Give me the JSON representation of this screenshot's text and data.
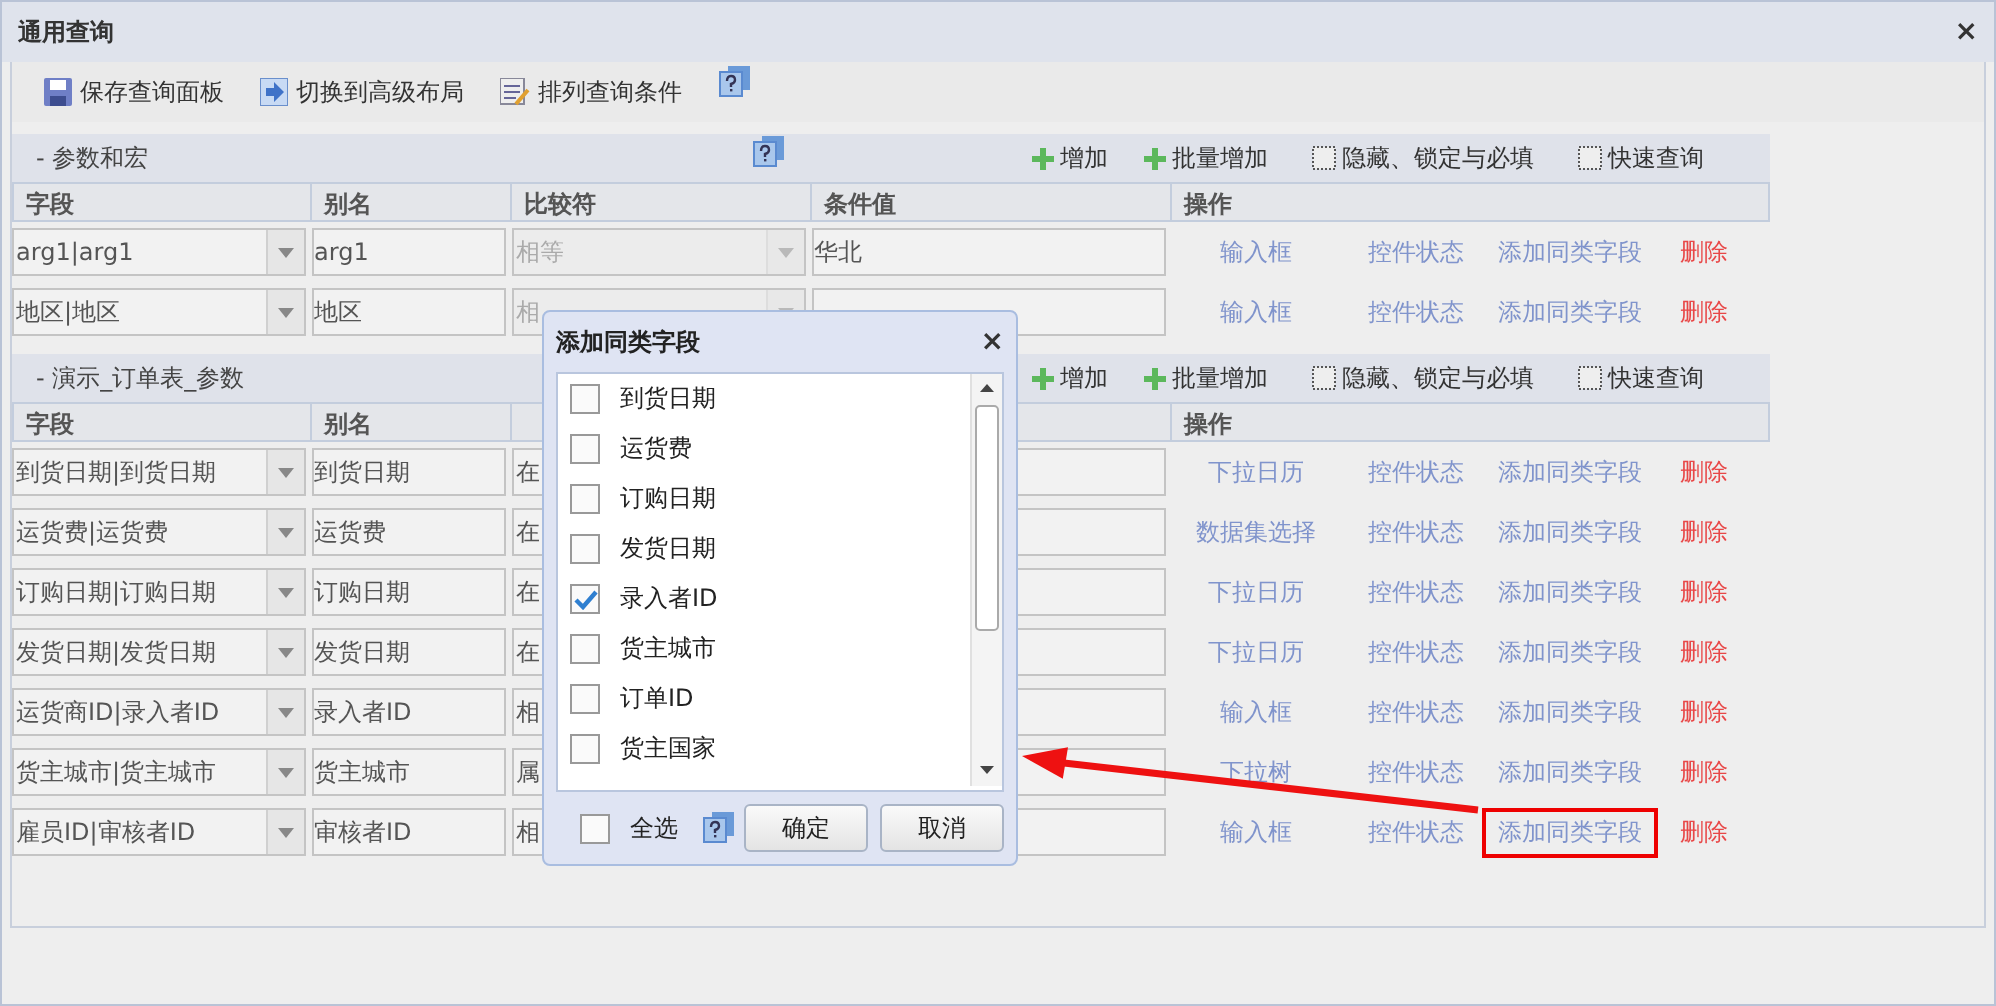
{
  "window": {
    "title": "通用查询",
    "close": "×"
  },
  "toolbar": [
    {
      "label": "保存查询面板",
      "kind": "save"
    },
    {
      "label": "切换到高级布局",
      "kind": "switch"
    },
    {
      "label": "排列查询条件",
      "kind": "sort"
    },
    {
      "kind": "help"
    }
  ],
  "sections": [
    {
      "title": "- 参数和宏",
      "actions": [
        {
          "label": "增加",
          "kind": "add"
        },
        {
          "label": "批量增加",
          "kind": "add"
        },
        {
          "label": "隐藏、锁定与必填",
          "kind": "option"
        },
        {
          "label": "快速查询",
          "kind": "option"
        }
      ],
      "columns": [
        "字段",
        "别名",
        "比较符",
        "条件值",
        "操作"
      ],
      "rows": [
        {
          "field": "arg1|arg1",
          "alias": "arg1",
          "comparator": {
            "text": "相等",
            "disabled": true
          },
          "value": "华北",
          "actions": [
            {
              "label": "输入框",
              "kind": "link",
              "highlighted": false
            },
            {
              "label": "控件状态",
              "kind": "link",
              "highlighted": false
            },
            {
              "label": "添加同类字段",
              "kind": "link",
              "highlighted": false
            },
            {
              "label": "删除",
              "kind": "delete",
              "highlighted": false
            }
          ]
        },
        {
          "field": "地区|地区",
          "alias": "地区",
          "comparator": {
            "text": "相",
            "disabled": true
          },
          "actions": [
            {
              "label": "输入框",
              "kind": "link",
              "highlighted": false
            },
            {
              "label": "控件状态",
              "kind": "link",
              "highlighted": false
            },
            {
              "label": "添加同类字段",
              "kind": "link",
              "highlighted": false
            },
            {
              "label": "删除",
              "kind": "delete",
              "highlighted": false
            }
          ]
        }
      ]
    },
    {
      "title": "- 演示_订单表_参数",
      "actions": [
        {
          "label": "增加",
          "kind": "add"
        },
        {
          "label": "批量增加",
          "kind": "add"
        },
        {
          "label": "隐藏、锁定与必填",
          "kind": "option"
        },
        {
          "label": "快速查询",
          "kind": "option"
        }
      ],
      "columns": [
        "字段",
        "别名",
        null,
        null,
        "操作"
      ],
      "rows": [
        {
          "field": "到货日期|到货日期",
          "alias": "到货日期",
          "comparator": {
            "text": "在",
            "disabled": false
          },
          "actions": [
            {
              "label": "下拉日历",
              "kind": "link",
              "highlighted": false
            },
            {
              "label": "控件状态",
              "kind": "link",
              "highlighted": false
            },
            {
              "label": "添加同类字段",
              "kind": "link",
              "highlighted": false
            },
            {
              "label": "删除",
              "kind": "delete",
              "highlighted": false
            }
          ]
        },
        {
          "field": "运货费|运货费",
          "alias": "运货费",
          "comparator": {
            "text": "在",
            "disabled": false
          },
          "actions": [
            {
              "label": "数据集选择",
              "kind": "link",
              "highlighted": false
            },
            {
              "label": "控件状态",
              "kind": "link",
              "highlighted": false
            },
            {
              "label": "添加同类字段",
              "kind": "link",
              "highlighted": false
            },
            {
              "label": "删除",
              "kind": "delete",
              "highlighted": false
            }
          ]
        },
        {
          "field": "订购日期|订购日期",
          "alias": "订购日期",
          "comparator": {
            "text": "在",
            "disabled": false
          },
          "actions": [
            {
              "label": "下拉日历",
              "kind": "link",
              "highlighted": false
            },
            {
              "label": "控件状态",
              "kind": "link",
              "highlighted": false
            },
            {
              "label": "添加同类字段",
              "kind": "link",
              "highlighted": false
            },
            {
              "label": "删除",
              "kind": "delete",
              "highlighted": false
            }
          ]
        },
        {
          "field": "发货日期|发货日期",
          "alias": "发货日期",
          "comparator": {
            "text": "在",
            "disabled": false
          },
          "actions": [
            {
              "label": "下拉日历",
              "kind": "link",
              "highlighted": false
            },
            {
              "label": "控件状态",
              "kind": "link",
              "highlighted": false
            },
            {
              "label": "添加同类字段",
              "kind": "link",
              "highlighted": false
            },
            {
              "label": "删除",
              "kind": "delete",
              "highlighted": false
            }
          ]
        },
        {
          "field": "运货商ID|录入者ID",
          "alias": "录入者ID",
          "comparator": {
            "text": "相",
            "disabled": false
          },
          "actions": [
            {
              "label": "输入框",
              "kind": "link",
              "highlighted": false
            },
            {
              "label": "控件状态",
              "kind": "link",
              "highlighted": false
            },
            {
              "label": "添加同类字段",
              "kind": "link",
              "highlighted": false
            },
            {
              "label": "删除",
              "kind": "delete",
              "highlighted": false
            }
          ]
        },
        {
          "field": "货主城市|货主城市",
          "alias": "货主城市",
          "comparator": {
            "text": "属",
            "disabled": false
          },
          "actions": [
            {
              "label": "下拉树",
              "kind": "link",
              "highlighted": false
            },
            {
              "label": "控件状态",
              "kind": "link",
              "highlighted": false
            },
            {
              "label": "添加同类字段",
              "kind": "link",
              "highlighted": false
            },
            {
              "label": "删除",
              "kind": "delete",
              "highlighted": false
            }
          ]
        },
        {
          "field": "雇员ID|审核者ID",
          "alias": "审核者ID",
          "comparator": {
            "text": "相",
            "disabled": false
          },
          "actions": [
            {
              "label": "输入框",
              "kind": "link",
              "highlighted": false
            },
            {
              "label": "控件状态",
              "kind": "link",
              "highlighted": false
            },
            {
              "label": "添加同类字段",
              "kind": "link",
              "highlighted": true
            },
            {
              "label": "删除",
              "kind": "delete",
              "highlighted": false
            }
          ]
        }
      ]
    }
  ],
  "dialog": {
    "title": "添加同类字段",
    "close": "×",
    "items": [
      {
        "label": "到货日期",
        "checked": false
      },
      {
        "label": "运货费",
        "checked": false
      },
      {
        "label": "订购日期",
        "checked": false
      },
      {
        "label": "发货日期",
        "checked": false
      },
      {
        "label": "录入者ID",
        "checked": true
      },
      {
        "label": "货主城市",
        "checked": false
      },
      {
        "label": "订单ID",
        "checked": false
      },
      {
        "label": "货主国家",
        "checked": false
      }
    ],
    "select_all": {
      "label": "全选",
      "checked": false
    },
    "buttons": [
      "确定",
      "取消"
    ]
  }
}
